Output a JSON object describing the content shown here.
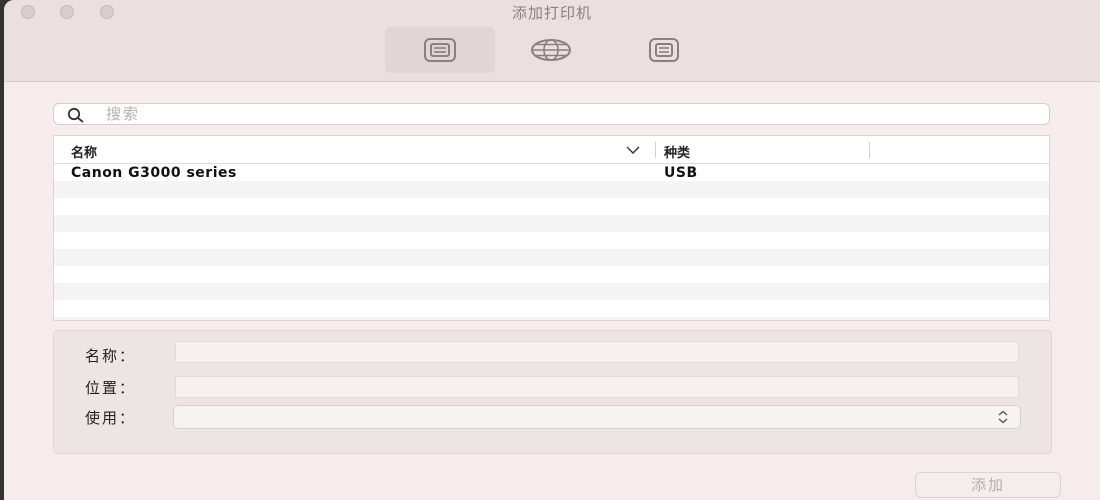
{
  "window": {
    "title": "添加打印机"
  },
  "toolbar": {
    "items": [
      {
        "icon": "default-printer-icon",
        "selected": true
      },
      {
        "icon": "ip-globe-icon",
        "selected": false
      },
      {
        "icon": "windows-printer-icon",
        "selected": false
      }
    ]
  },
  "search": {
    "placeholder": "搜索",
    "value": ""
  },
  "table": {
    "columns": [
      "名称",
      "种类"
    ],
    "rows": [
      {
        "name": "Canon G3000 series",
        "kind": "USB"
      }
    ]
  },
  "form": {
    "name_label": "名称：",
    "name_value": "",
    "location_label": "位置：",
    "location_value": "",
    "use_label": "使用：",
    "use_value": ""
  },
  "buttons": {
    "add_label": "添加"
  },
  "colors": {
    "window_bg": "#f6eceb",
    "toolbar_bg": "#ecdfdf",
    "selected_tool": "#e1d5d5"
  }
}
